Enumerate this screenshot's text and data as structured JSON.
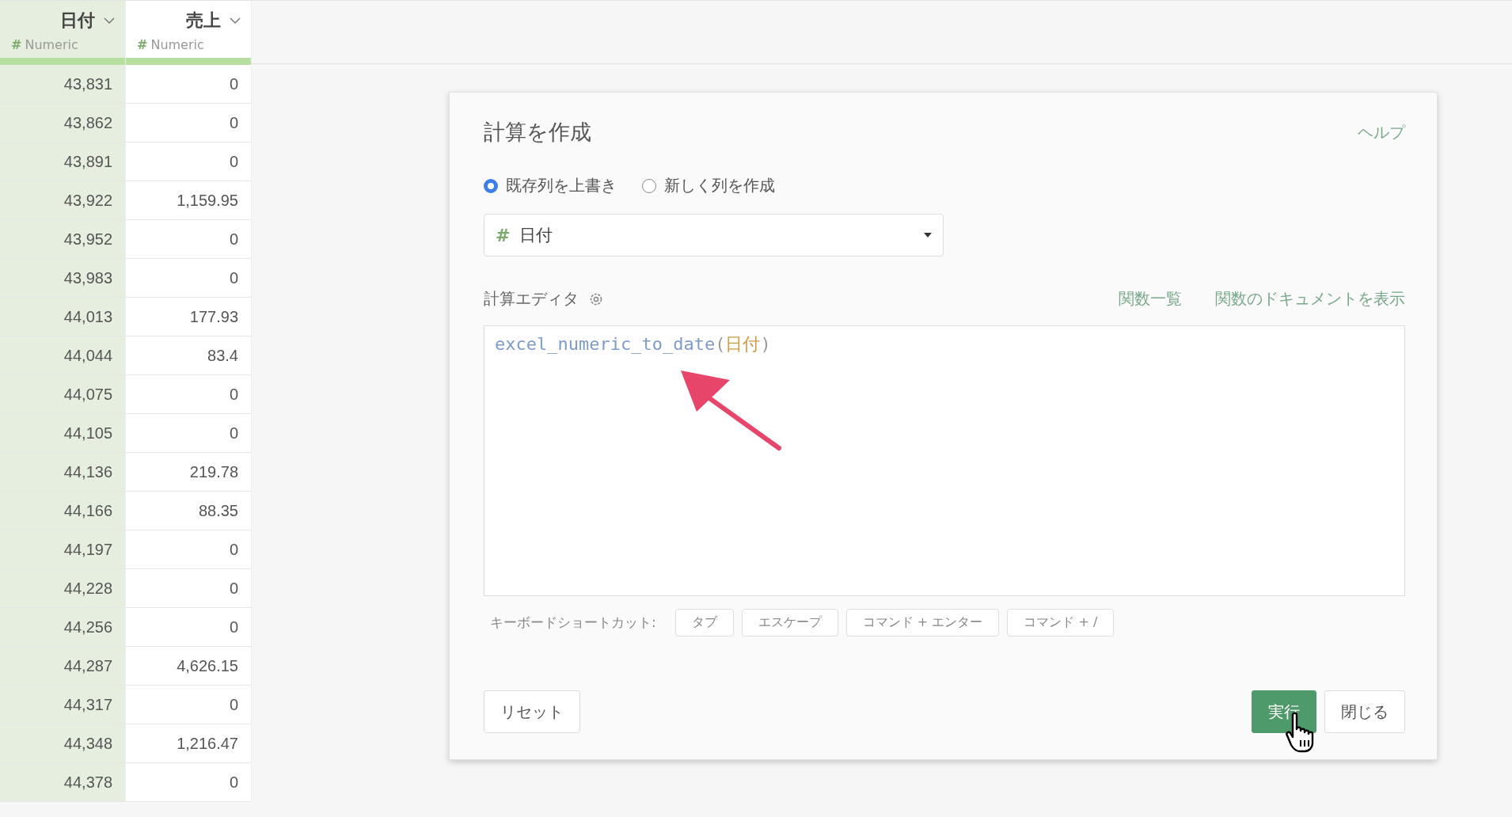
{
  "table": {
    "columns": [
      {
        "name": "日付",
        "type_mark": "#",
        "type": "Numeric",
        "selected": true
      },
      {
        "name": "売上",
        "type_mark": "#",
        "type": "Numeric",
        "selected": false
      }
    ],
    "rows": [
      [
        "43,831",
        "0"
      ],
      [
        "43,862",
        "0"
      ],
      [
        "43,891",
        "0"
      ],
      [
        "43,922",
        "1,159.95"
      ],
      [
        "43,952",
        "0"
      ],
      [
        "43,983",
        "0"
      ],
      [
        "44,013",
        "177.93"
      ],
      [
        "44,044",
        "83.4"
      ],
      [
        "44,075",
        "0"
      ],
      [
        "44,105",
        "0"
      ],
      [
        "44,136",
        "219.78"
      ],
      [
        "44,166",
        "88.35"
      ],
      [
        "44,197",
        "0"
      ],
      [
        "44,228",
        "0"
      ],
      [
        "44,256",
        "0"
      ],
      [
        "44,287",
        "4,626.15"
      ],
      [
        "44,317",
        "0"
      ],
      [
        "44,348",
        "1,216.47"
      ],
      [
        "44,378",
        "0"
      ]
    ]
  },
  "dialog": {
    "title": "計算を作成",
    "help": "ヘルプ",
    "modes": [
      {
        "label": "既存列を上書き",
        "selected": true
      },
      {
        "label": "新しく列を作成",
        "selected": false
      }
    ],
    "column_select": {
      "mark": "#",
      "value": "日付"
    },
    "editor_label": "計算エディタ",
    "links": [
      "関数一覧",
      "関数のドキュメントを表示"
    ],
    "code": [
      {
        "kind": "function",
        "text": "excel_numeric_to_date"
      },
      {
        "kind": "punct",
        "text": "("
      },
      {
        "kind": "column",
        "text": "日付"
      },
      {
        "kind": "punct",
        "text": ")"
      }
    ],
    "shortcuts_label": "キーボードショートカット:",
    "shortcuts": [
      "タブ",
      "エスケープ",
      "コマンド + エンター",
      "コマンド + /"
    ],
    "reset": "リセット",
    "run": "実行",
    "close": "閉じる"
  }
}
